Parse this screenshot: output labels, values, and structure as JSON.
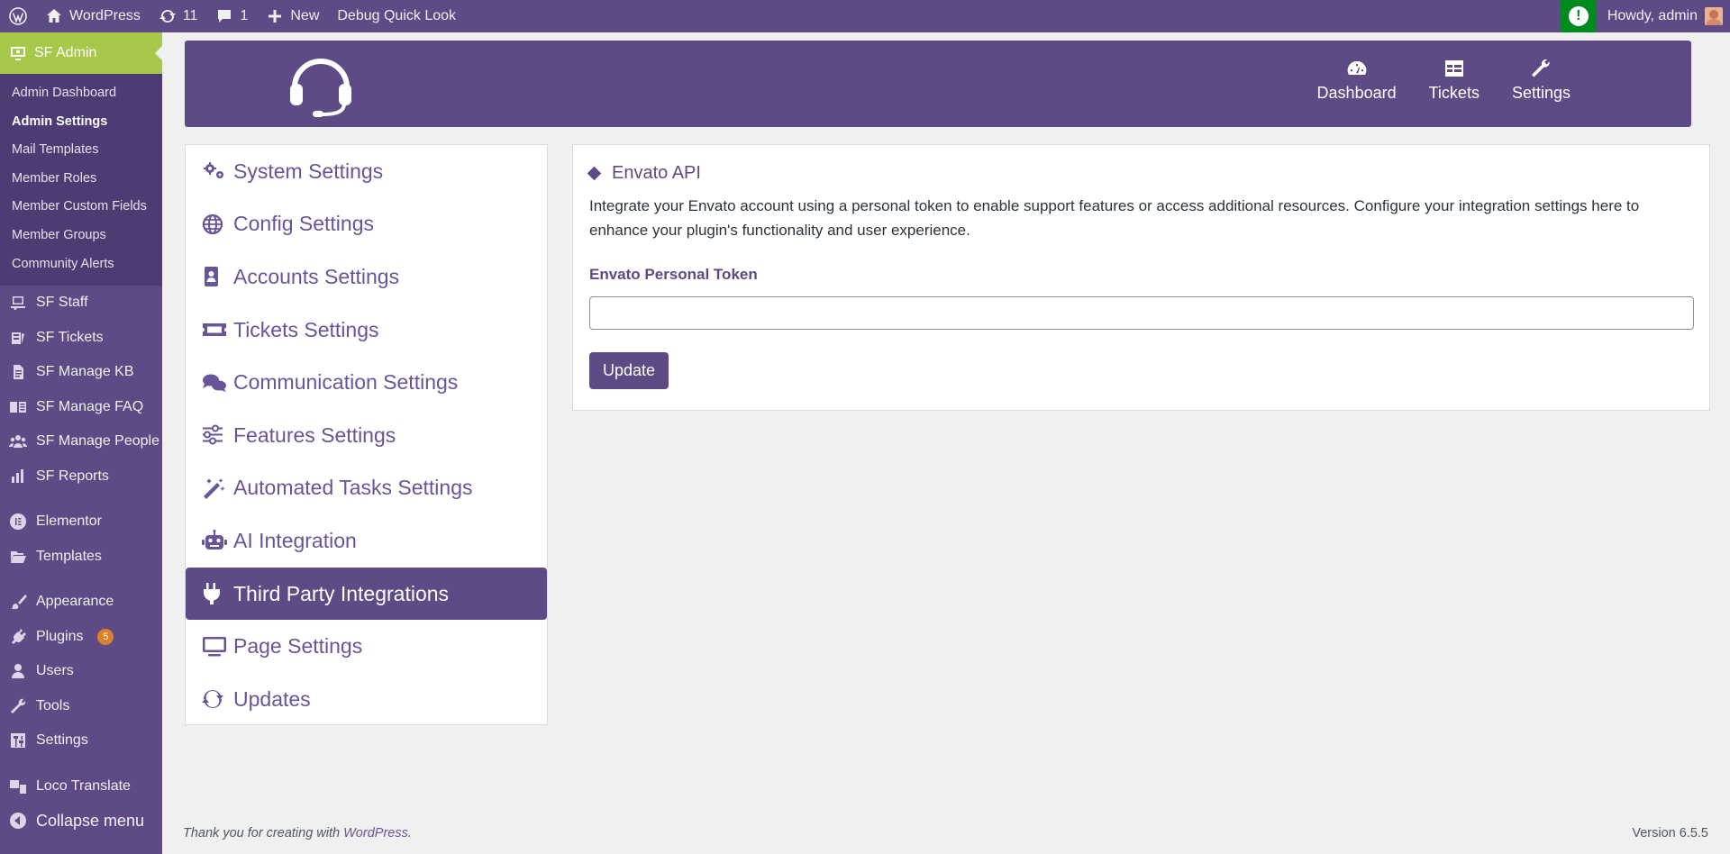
{
  "adminbar": {
    "site_name": "WordPress",
    "updates_count": "11",
    "comments_count": "1",
    "new_label": "New",
    "debug_label": "Debug Quick Look",
    "howdy": "Howdy, admin"
  },
  "sidebar": {
    "active_label": "SF Admin",
    "submenu": [
      "Admin Dashboard",
      "Admin Settings",
      "Mail Templates",
      "Member Roles",
      "Member Custom Fields",
      "Member Groups",
      "Community Alerts"
    ],
    "group1": [
      "SF Staff",
      "SF Tickets",
      "SF Manage KB",
      "SF Manage FAQ",
      "SF Manage People",
      "SF Reports"
    ],
    "group2": [
      "Elementor",
      "Templates"
    ],
    "group3": [
      "Appearance",
      "Plugins",
      "Users",
      "Tools",
      "Settings"
    ],
    "plugins_badge": "5",
    "group4": [
      "Loco Translate"
    ],
    "collapse_label": "Collapse menu"
  },
  "header": {
    "nav": [
      "Dashboard",
      "Tickets",
      "Settings"
    ]
  },
  "settings_nav": [
    "System Settings",
    "Config Settings",
    "Accounts Settings",
    "Tickets Settings",
    "Communication Settings",
    "Features Settings",
    "Automated Tasks Settings",
    "AI Integration",
    "Third Party Integrations",
    "Page Settings",
    "Updates"
  ],
  "panel": {
    "title": "Envato API",
    "description": "Integrate your Envato account using a personal token to enable support features or access additional resources. Configure your integration settings here to enhance your plugin's functionality and user experience.",
    "field_label": "Envato Personal Token",
    "field_value": "",
    "update_label": "Update"
  },
  "footer": {
    "thanks_prefix": "Thank you for creating with ",
    "wp_link": "WordPress",
    "thanks_suffix": ".",
    "version": "Version 6.5.5"
  },
  "colors": {
    "brand": "#5e4a85",
    "accent": "#a7c94a",
    "alert": "#008a20"
  }
}
